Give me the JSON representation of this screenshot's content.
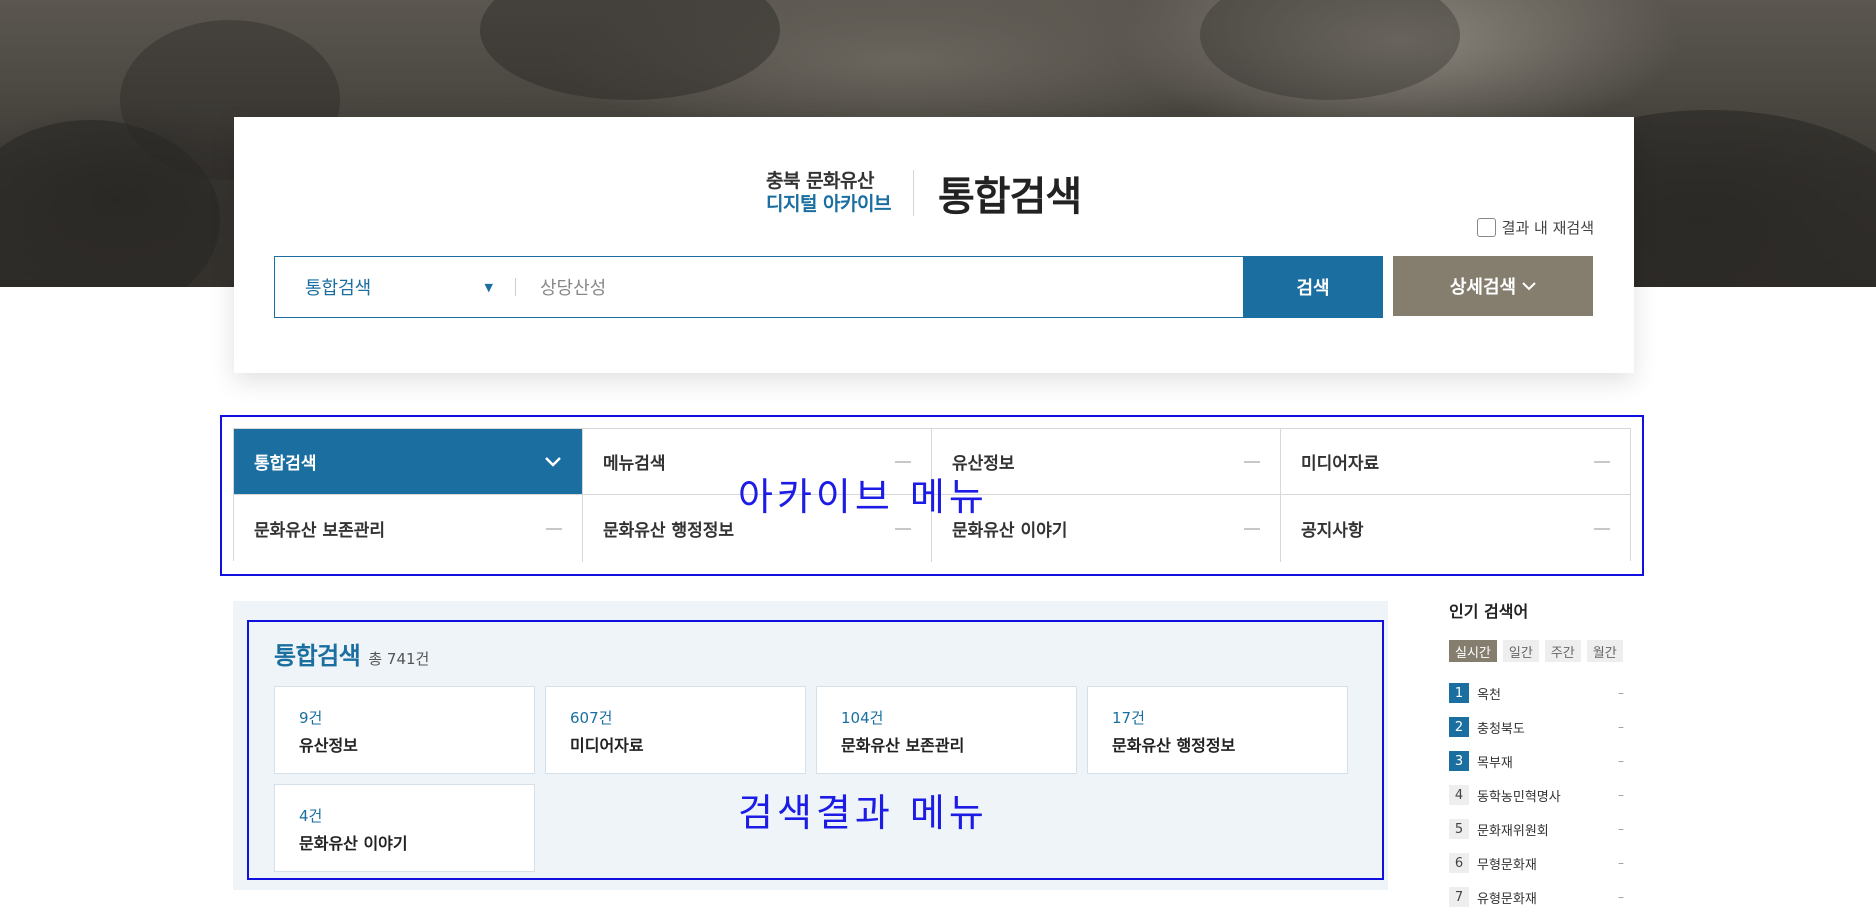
{
  "brand": {
    "line1": "충북 문화유산",
    "line2": "디지털 아카이브",
    "title": "통합검색"
  },
  "search": {
    "research_label": "결과 내 재검색",
    "select_value": "통합검색",
    "input_value": "상당산성",
    "search_button": "검색",
    "detail_button": "상세검색"
  },
  "menu": {
    "annotation": "아카이브 메뉴",
    "items": [
      {
        "label": "통합검색",
        "active": true
      },
      {
        "label": "메뉴검색"
      },
      {
        "label": "유산정보"
      },
      {
        "label": "미디어자료"
      },
      {
        "label": "문화유산 보존관리"
      },
      {
        "label": "문화유산 행정정보"
      },
      {
        "label": "문화유산 이야기"
      },
      {
        "label": "공지사항"
      }
    ]
  },
  "results": {
    "annotation": "검색결과 메뉴",
    "title": "통합검색",
    "total": "총 741건",
    "cards": [
      {
        "count": "9건",
        "label": "유산정보"
      },
      {
        "count": "607건",
        "label": "미디어자료"
      },
      {
        "count": "104건",
        "label": "문화유산 보존관리"
      },
      {
        "count": "17건",
        "label": "문화유산 행정정보"
      },
      {
        "count": "4건",
        "label": "문화유산 이야기"
      }
    ]
  },
  "popular": {
    "title": "인기 검색어",
    "tabs": [
      "실시간",
      "일간",
      "주간",
      "월간"
    ],
    "items": [
      {
        "rank": "1",
        "name": "옥천",
        "change": "–"
      },
      {
        "rank": "2",
        "name": "충청북도",
        "change": "–"
      },
      {
        "rank": "3",
        "name": "목부재",
        "change": "–"
      },
      {
        "rank": "4",
        "name": "동학농민혁명사",
        "change": "–"
      },
      {
        "rank": "5",
        "name": "문화재위원회",
        "change": "–"
      },
      {
        "rank": "6",
        "name": "무형문화재",
        "change": "–"
      },
      {
        "rank": "7",
        "name": "유형문화재",
        "change": "–"
      }
    ]
  },
  "colors": {
    "primary": "#1a6ea0",
    "secondary": "#857e6f",
    "annotation": "#1010e0"
  }
}
